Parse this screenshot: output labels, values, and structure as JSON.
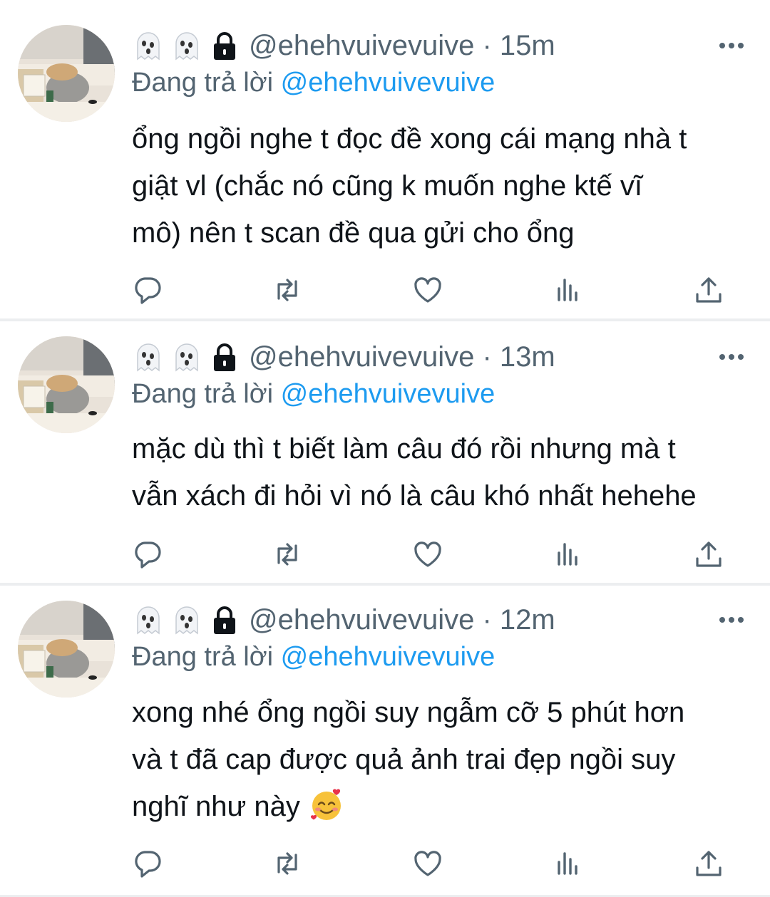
{
  "tweets": [
    {
      "handle": "@ehehvuivevuive",
      "time": "· 15m",
      "reply_prefix": "Đang trả lời ",
      "reply_to": "@ehehvuivevuive",
      "text": "ổng ngồi nghe t đọc đề xong cái mạng nhà t\ngiật vl (chắc nó cũng k muốn nghe ktế vĩ\nmô) nên t scan đề qua gửi cho ổng"
    },
    {
      "handle": "@ehehvuivevuive",
      "time": "· 13m",
      "reply_prefix": "Đang trả lời ",
      "reply_to": "@ehehvuivevuive",
      "text": "mặc dù thì t biết làm câu đó rồi nhưng mà t\nvẫn xách đi hỏi vì nó là câu khó nhất hehehe"
    },
    {
      "handle": "@ehehvuivevuive",
      "time": "· 12m",
      "reply_prefix": "Đang trả lời ",
      "reply_to": "@ehehvuivevuive",
      "text": "xong nhé ổng ngồi suy ngẫm cỡ 5 phút hơn\nvà t đã cap được quả ảnh trai đẹp ngồi suy\nnghĩ như này ",
      "trailing_emoji": "smiling-face-with-hearts"
    }
  ],
  "icons": {
    "name_emojis": [
      "ghost",
      "ghost",
      "lock"
    ],
    "more": "more-dots-icon",
    "actions": [
      "reply-icon",
      "retweet-icon",
      "like-icon",
      "views-icon",
      "share-icon"
    ]
  },
  "colors": {
    "text": "#0f1419",
    "secondary": "#536471",
    "mention": "#1d9bf0",
    "divider": "#eceef0"
  }
}
